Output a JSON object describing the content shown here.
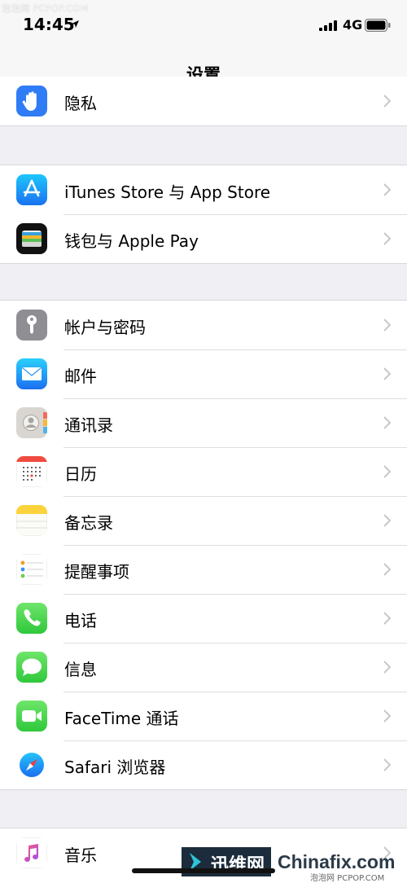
{
  "watermark_top": "泡泡网 PCPOP.COM",
  "status": {
    "time": "14:45",
    "network": "4G"
  },
  "nav": {
    "title": "设置"
  },
  "items": {
    "privacy": "隐私",
    "itunes": "iTunes Store 与 App Store",
    "wallet": "钱包与 Apple Pay",
    "accounts": "帐户与密码",
    "mail": "邮件",
    "contacts": "通讯录",
    "calendar": "日历",
    "notes": "备忘录",
    "reminders": "提醒事项",
    "phone": "电话",
    "messages": "信息",
    "facetime": "FaceTime 通话",
    "safari": "Safari 浏览器",
    "music": "音乐"
  },
  "watermark_bottom": {
    "brand": "迅维网",
    "site": "Chinafix.com",
    "small": "泡泡网 PCPOP.COM"
  },
  "colors": {
    "accent": "#007aff",
    "background": "#efeff4",
    "chevron": "#c7c7cc"
  }
}
